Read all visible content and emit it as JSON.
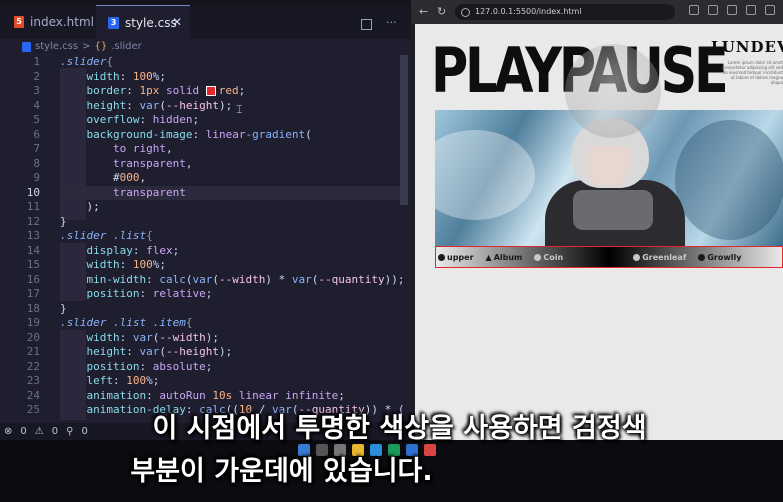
{
  "editor": {
    "tabs": [
      {
        "label": "index.html",
        "icon": "html5-icon"
      },
      {
        "label": "style.css",
        "icon": "css3-icon",
        "close": "✕"
      }
    ],
    "breadcrumb": {
      "file": "style.css",
      "separator": ">",
      "symbol": ".slider"
    },
    "active_line": 10,
    "line_numbers": [
      "1",
      "2",
      "3",
      "4",
      "5",
      "6",
      "7",
      "8",
      "9",
      "10",
      "11",
      "12",
      "13",
      "14",
      "15",
      "16",
      "17",
      "18",
      "19",
      "20",
      "21",
      "22",
      "23",
      "24",
      "25"
    ],
    "lines": [
      ".slider{",
      "    width: 100%;",
      "    border: 1px solid red;",
      "    height: var(--height);",
      "    overflow: hidden;",
      "    background-image: linear-gradient(",
      "        to right,",
      "        transparent,",
      "        #000,",
      "        transparent",
      "    );",
      "}",
      ".slider .list{",
      "    display: flex;",
      "    width: 100%;",
      "    min-width: calc(var(--width) * var(--quantity));",
      "    position: relative;",
      "}",
      ".slider .list .item{",
      "    width: var(--width);",
      "    height: var(--height);",
      "    position: absolute;",
      "    left: 100%;",
      "    animation: autoRun 10s linear infinite;",
      "    animation-delay: calc((10 / var(--quantity)) * ("
    ],
    "status": {
      "errors": "0",
      "warnings": "0",
      "ports": "0"
    }
  },
  "browser": {
    "url": "127.0.0.1:5500/index.html",
    "page": {
      "title": "PLAYPAUSE",
      "subtitle": "LUNDEV",
      "description": "Lorem ipsum dolor sit amet consectetur adipiscing elit sed do eiusmod tempor incididunt ut labore et dolore magna aliqua",
      "logos": [
        "upper",
        "Album",
        "Coin",
        "",
        "Greenleaf",
        "Growlly"
      ]
    }
  },
  "captions": {
    "line1": "이 시점에서 투명한 색상을 사용하면 검정색",
    "line2": "부분이 가운데에 있습니다."
  },
  "colors": {
    "editor_bg": "#1e1e2e",
    "accent_red": "#e5262a",
    "page_bg": "#e9e9e9"
  }
}
